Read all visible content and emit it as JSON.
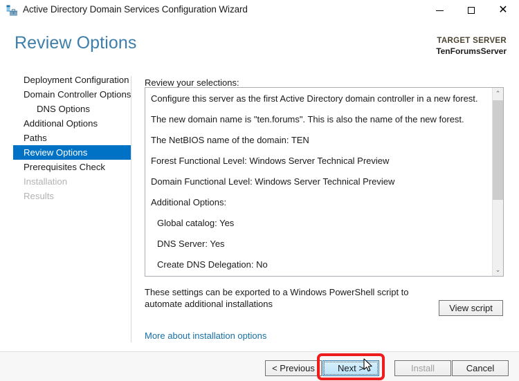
{
  "window": {
    "title": "Active Directory Domain Services Configuration Wizard",
    "icon": "ad-server-icon",
    "controls": {
      "minimize": "–",
      "maximize": "□",
      "close": "✕"
    }
  },
  "header": {
    "page_title": "Review Options",
    "target_server_label": "TARGET SERVER",
    "target_server_name": "TenForumsServer"
  },
  "sidebar": {
    "items": [
      {
        "label": "Deployment Configuration",
        "state": "normal",
        "sub": false
      },
      {
        "label": "Domain Controller Options",
        "state": "normal",
        "sub": false
      },
      {
        "label": "DNS Options",
        "state": "normal",
        "sub": true
      },
      {
        "label": "Additional Options",
        "state": "normal",
        "sub": false
      },
      {
        "label": "Paths",
        "state": "normal",
        "sub": false
      },
      {
        "label": "Review Options",
        "state": "selected",
        "sub": false
      },
      {
        "label": "Prerequisites Check",
        "state": "normal",
        "sub": false
      },
      {
        "label": "Installation",
        "state": "disabled",
        "sub": false
      },
      {
        "label": "Results",
        "state": "disabled",
        "sub": false
      }
    ]
  },
  "main": {
    "review_label": "Review your selections:",
    "review_lines": [
      {
        "text": "Configure this server as the first Active Directory domain controller in a new forest.",
        "indent": false
      },
      {
        "text": "The new domain name is \"ten.forums\". This is also the name of the new forest.",
        "indent": false
      },
      {
        "text": "The NetBIOS name of the domain: TEN",
        "indent": false
      },
      {
        "text": "Forest Functional Level: Windows Server Technical Preview",
        "indent": false
      },
      {
        "text": "Domain Functional Level: Windows Server Technical Preview",
        "indent": false
      },
      {
        "text": "Additional Options:",
        "indent": false
      },
      {
        "text": "Global catalog: Yes",
        "indent": true
      },
      {
        "text": "DNS Server: Yes",
        "indent": true
      },
      {
        "text": "Create DNS Delegation: No",
        "indent": true
      }
    ],
    "scrollbar": {
      "up_arrow": "⌃",
      "down_arrow": "⌄"
    },
    "powershell_note": "These settings can be exported to a Windows PowerShell script to automate additional installations",
    "view_script_label": "View script",
    "more_link_label": "More about installation options"
  },
  "footer": {
    "previous_label": "< Previous",
    "next_label": "Next >",
    "install_label": "Install",
    "cancel_label": "Cancel"
  },
  "annotation": {
    "highlight_target": "next-button",
    "highlight_color": "#ee1c1c"
  }
}
